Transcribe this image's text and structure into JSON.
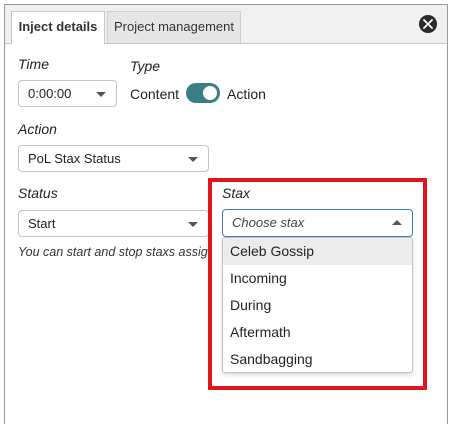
{
  "tabs": [
    {
      "label": "Inject details",
      "active": true
    },
    {
      "label": "Project management",
      "active": false
    }
  ],
  "time": {
    "label": "Time",
    "value": "0:00:00"
  },
  "type": {
    "label": "Type",
    "left_option": "Content",
    "right_option": "Action",
    "selected": "Action"
  },
  "action": {
    "label": "Action",
    "value": "PoL Stax Status"
  },
  "status": {
    "label": "Status",
    "value": "Start"
  },
  "hint": "You can start and stop staxs assig",
  "stax": {
    "label": "Stax",
    "placeholder": "Choose stax",
    "options": [
      "Celeb Gossip",
      "Incoming",
      "During",
      "Aftermath",
      "Sandbagging"
    ],
    "highlighted_option": "Celeb Gossip"
  },
  "colors": {
    "toggle": "#3a7f86",
    "highlight_box": "#e0141b",
    "focus_border": "#3f7ea6"
  }
}
